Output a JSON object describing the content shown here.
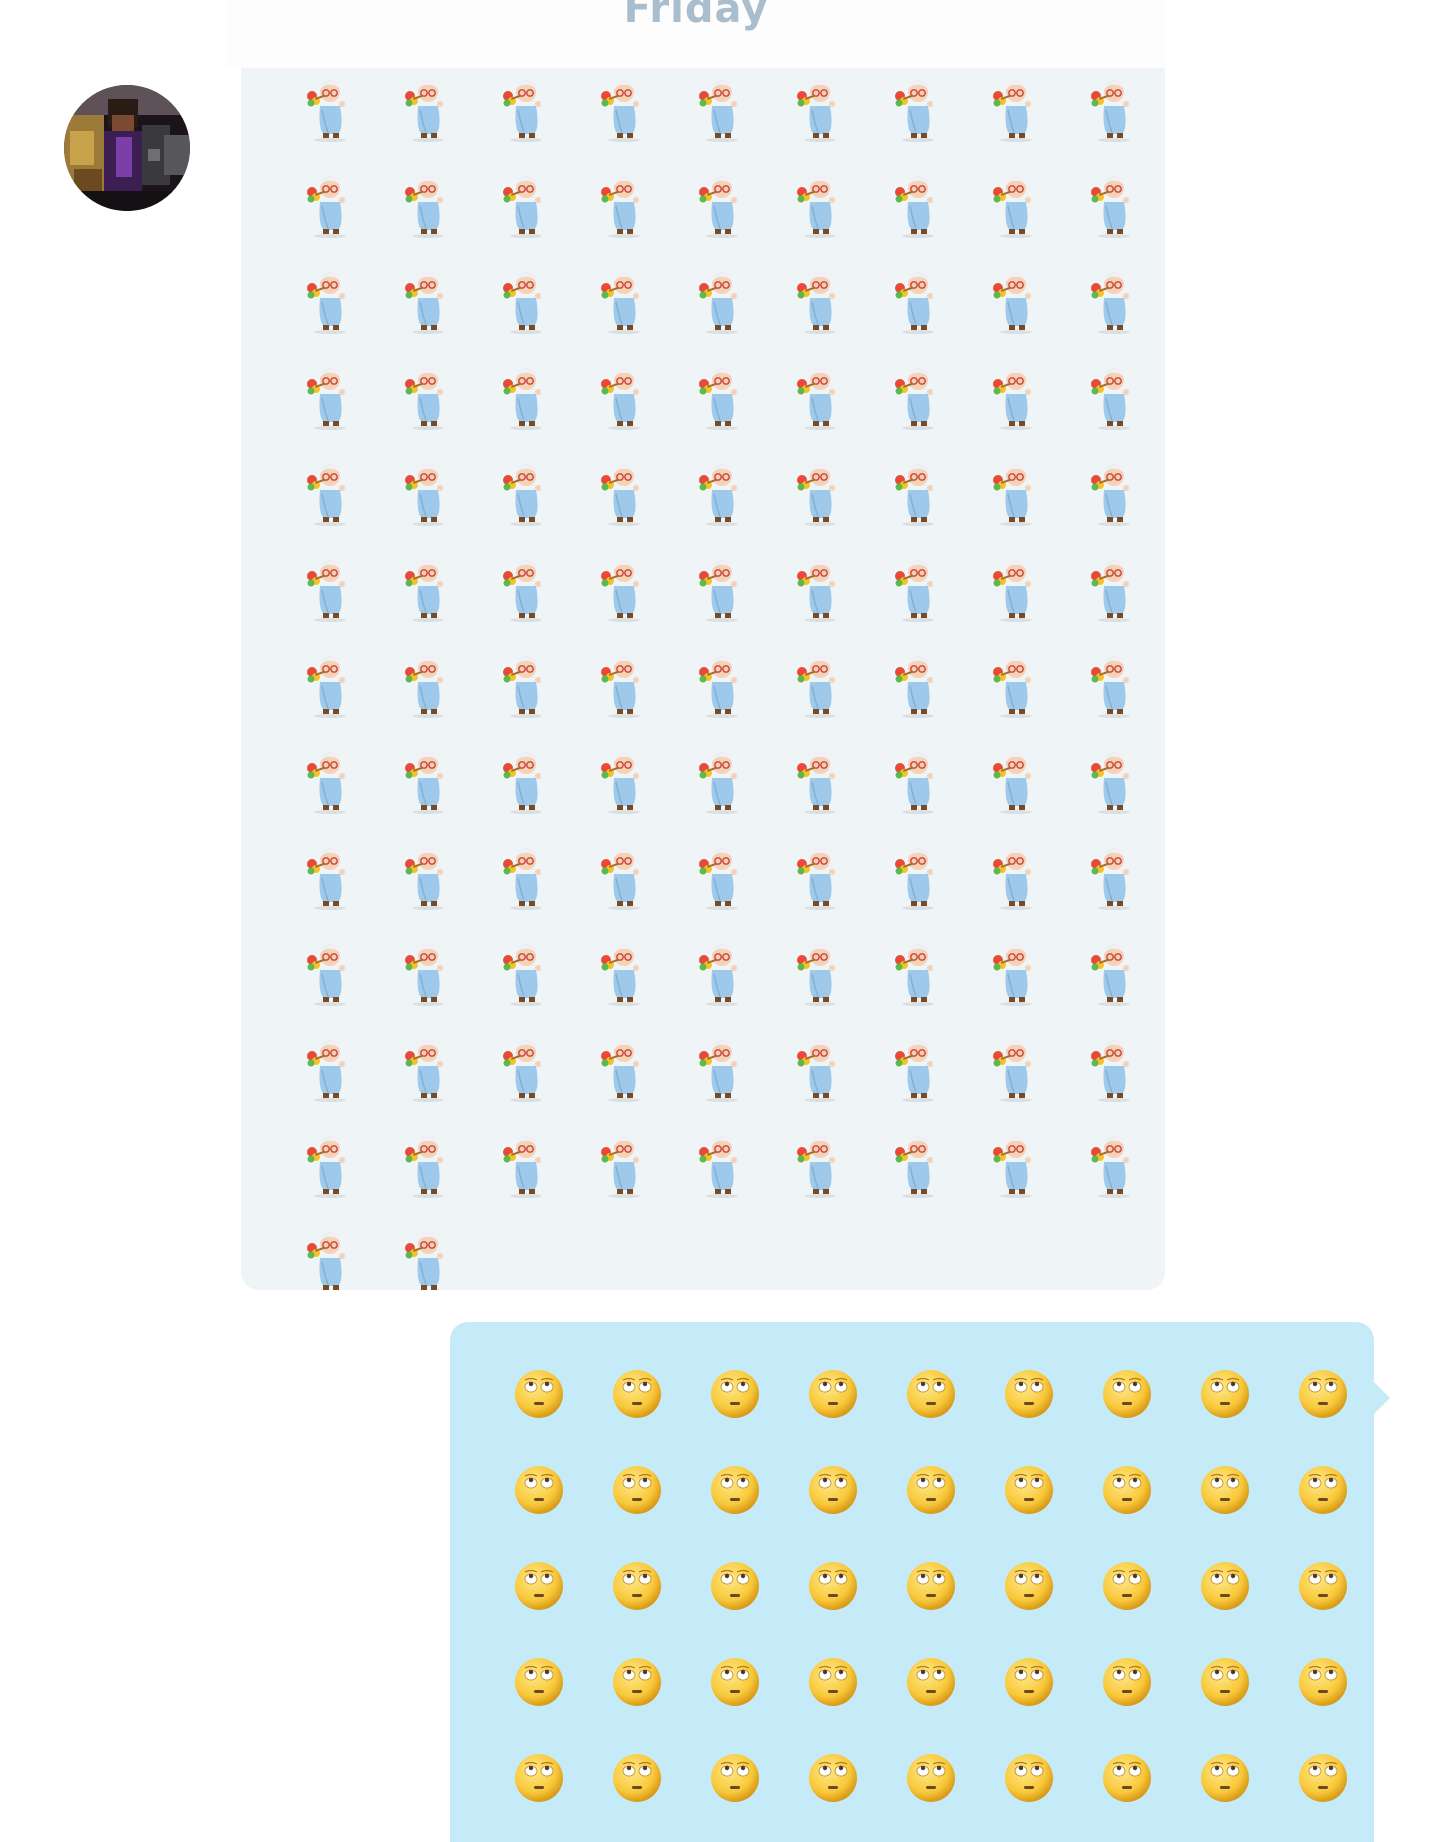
{
  "chat": {
    "date_separator": "Friday",
    "incoming_message": {
      "sender_avatar": "user-avatar",
      "emoticon": "granny-dancing-emoticon",
      "emoticon_icon": "granny-dancing-icon",
      "count": 110,
      "bubble_color": "#eff4f7"
    },
    "outgoing_message": {
      "emoticon": "eye-roll-emoticon",
      "emoticon_icon": "eye-roll-face-icon",
      "visible_count": 45,
      "bubble_color": "#c6ebf8"
    }
  },
  "colors": {
    "date_separator_text": "#aabdcc",
    "background": "#ffffff"
  }
}
